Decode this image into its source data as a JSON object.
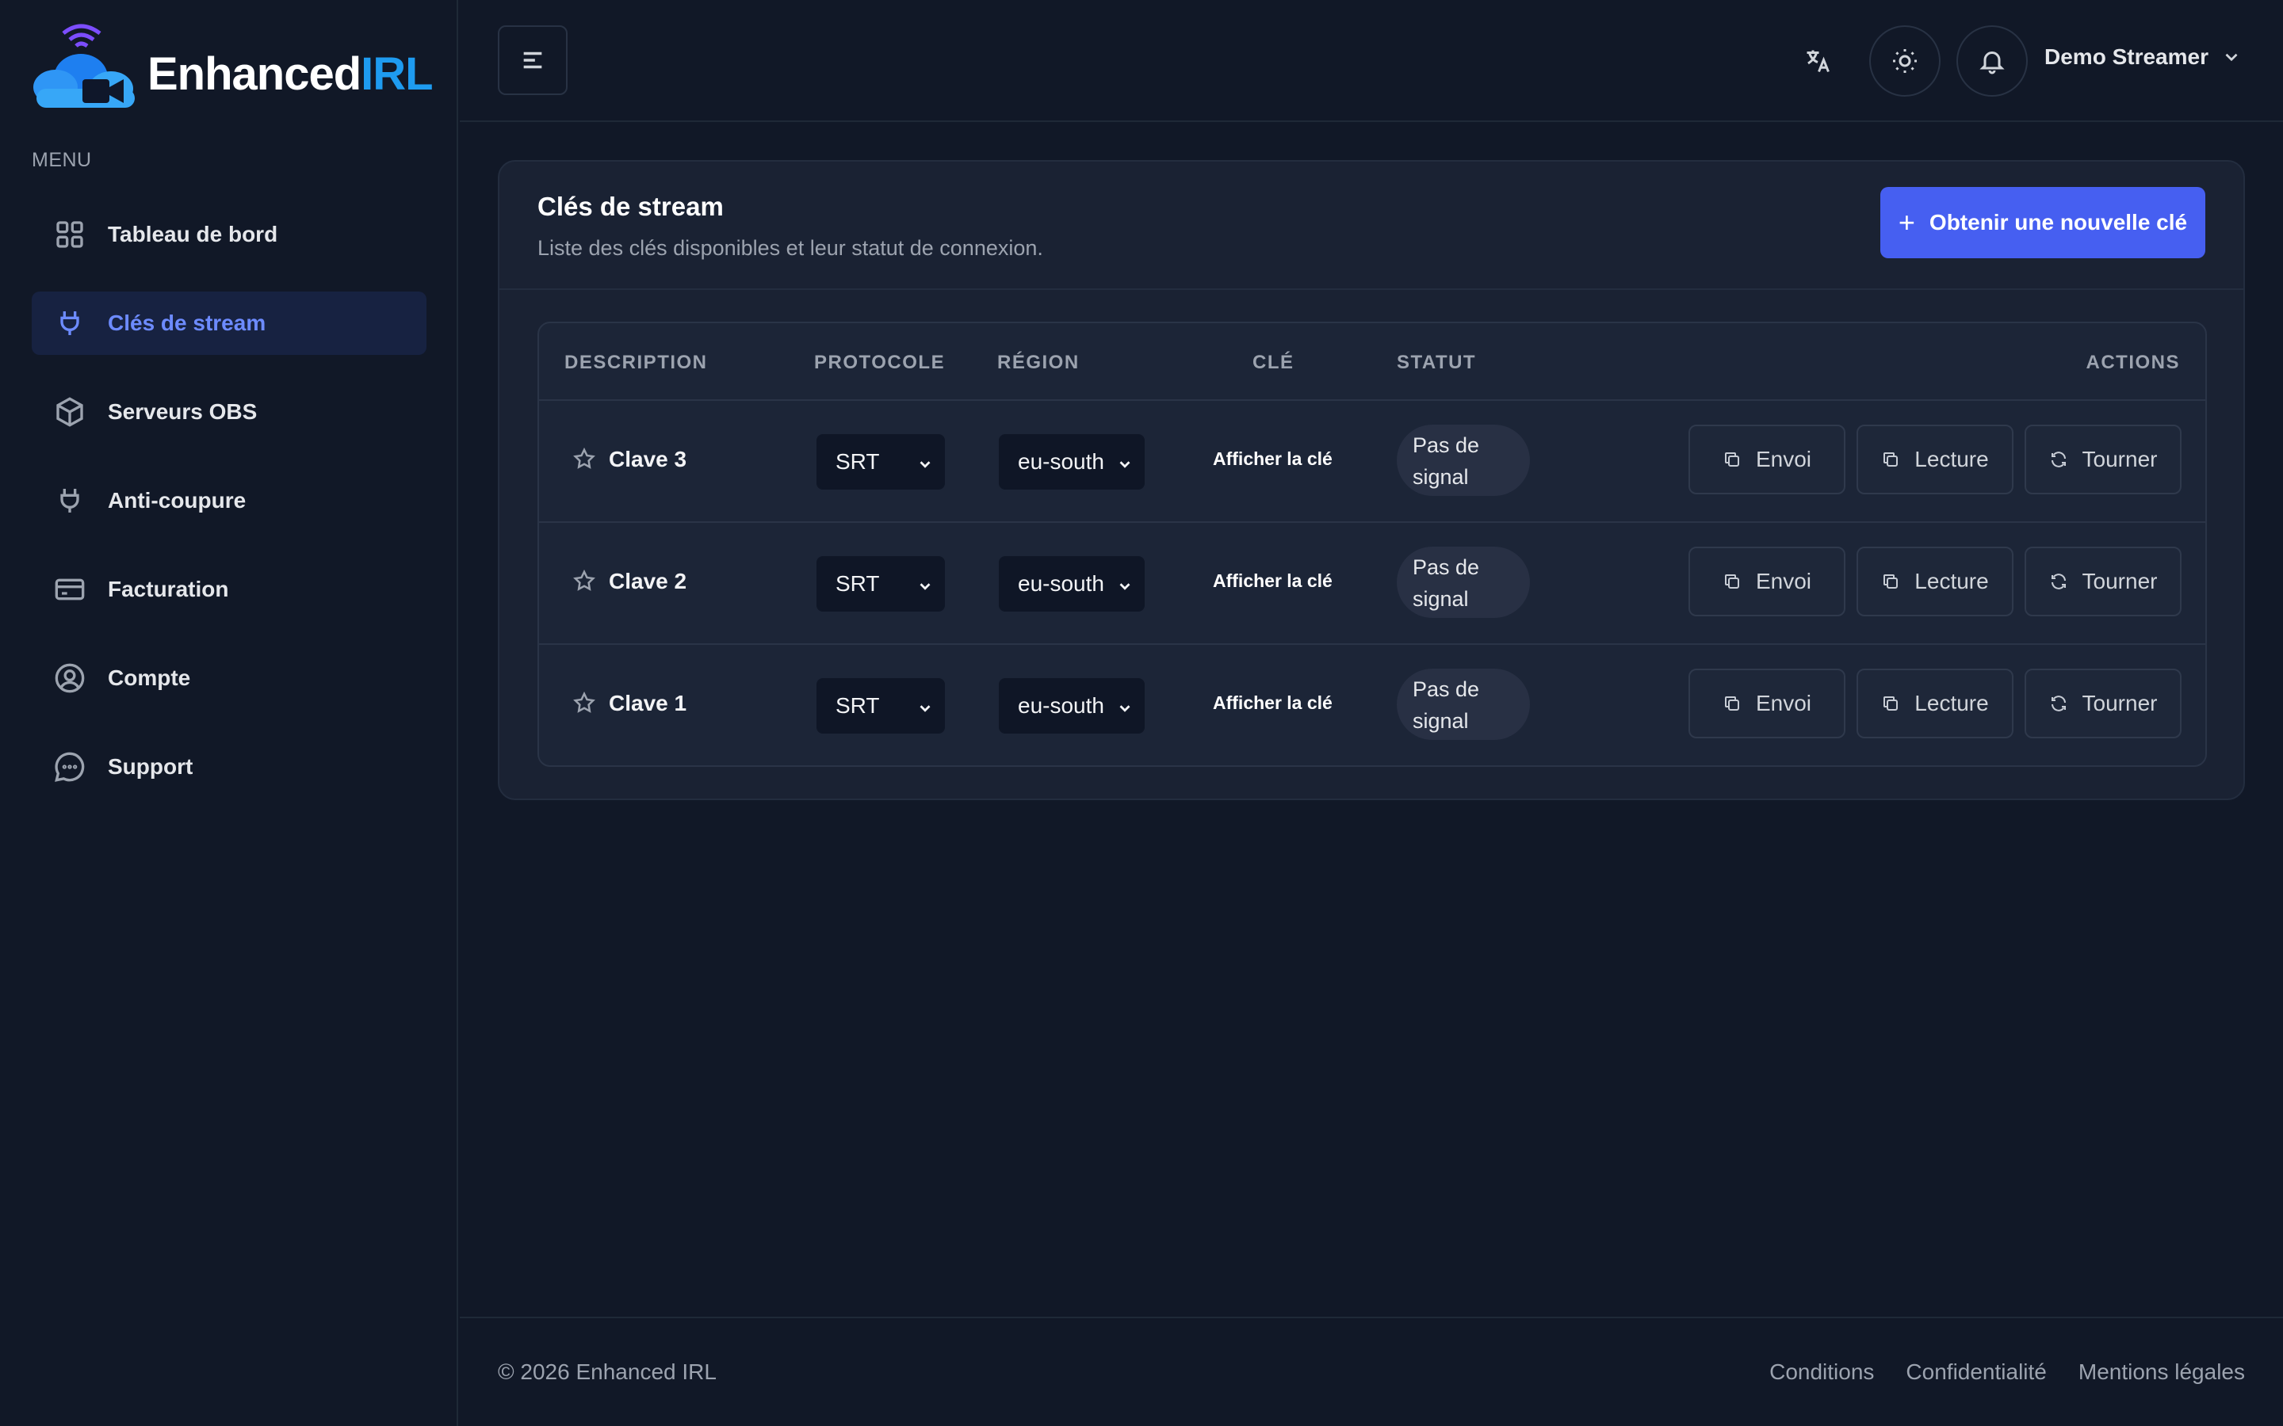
{
  "brand": {
    "part1": "Enhanced",
    "part2": "IRL"
  },
  "sidebar": {
    "menu_title": "MENU",
    "items": [
      {
        "label": "Tableau de bord",
        "icon": "grid-icon",
        "active": false
      },
      {
        "label": "Clés de stream",
        "icon": "plug-icon",
        "active": true
      },
      {
        "label": "Serveurs OBS",
        "icon": "box-icon",
        "active": false
      },
      {
        "label": "Anti-coupure",
        "icon": "plug-icon",
        "active": false
      },
      {
        "label": "Facturation",
        "icon": "credit-card-icon",
        "active": false
      },
      {
        "label": "Compte",
        "icon": "user-circle-icon",
        "active": false
      },
      {
        "label": "Support",
        "icon": "chat-icon",
        "active": false
      }
    ]
  },
  "header": {
    "user_name": "Demo Streamer"
  },
  "card": {
    "title": "Clés de stream",
    "subtitle": "Liste des clés disponibles et leur statut de connexion.",
    "new_key_label": "Obtenir une nouvelle clé"
  },
  "table": {
    "columns": {
      "description": "DESCRIPTION",
      "protocol": "PROTOCOLE",
      "region": "RÉGION",
      "key": "CLÉ",
      "status": "STATUT",
      "actions": "ACTIONS"
    },
    "rows": [
      {
        "name": "Clave 3",
        "protocol": "SRT",
        "region": "eu-south",
        "key_label": "Afficher la clé",
        "status": "Pas de signal"
      },
      {
        "name": "Clave 2",
        "protocol": "SRT",
        "region": "eu-south",
        "key_label": "Afficher la clé",
        "status": "Pas de signal"
      },
      {
        "name": "Clave 1",
        "protocol": "SRT",
        "region": "eu-south",
        "key_label": "Afficher la clé",
        "status": "Pas de signal"
      }
    ],
    "actions": {
      "send": "Envoi",
      "play": "Lecture",
      "rotate": "Tourner"
    }
  },
  "footer": {
    "copyright": "© 2026 Enhanced IRL",
    "links": [
      "Conditions",
      "Confidentialité",
      "Mentions légales"
    ]
  },
  "colors": {
    "accent": "#465ff1",
    "brand_blue": "#1e9bf0",
    "background": "#111827"
  }
}
